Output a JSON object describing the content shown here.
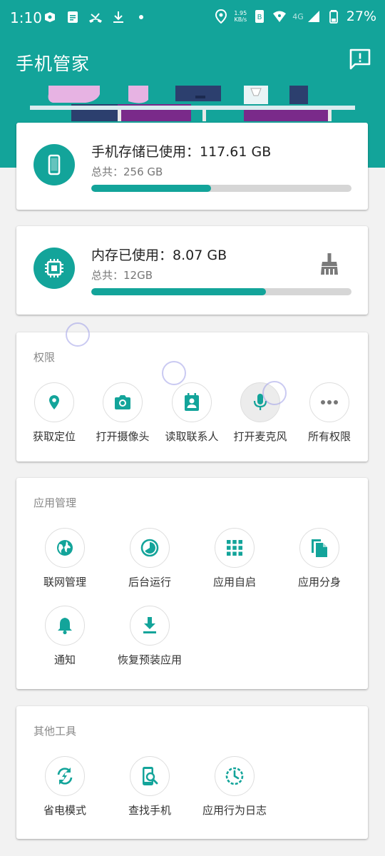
{
  "status_bar": {
    "time": "1:10",
    "net_speed_value": "1.95",
    "net_speed_unit": "KB/s",
    "network_type": "4G",
    "battery": "27%"
  },
  "app_bar": {
    "title": "手机管家"
  },
  "storage": {
    "used_label": "手机存储已使用：117.61 GB",
    "total_label": "总共：256 GB",
    "used_fraction": 0.46
  },
  "memory": {
    "used_label": "内存已使用：8.07 GB",
    "total_label": "总共：12GB",
    "used_fraction": 0.67
  },
  "permissions": {
    "title": "权限",
    "items": [
      {
        "label": "获取定位",
        "icon": "location-icon"
      },
      {
        "label": "打开摄像头",
        "icon": "camera-icon"
      },
      {
        "label": "读取联系人",
        "icon": "contacts-icon"
      },
      {
        "label": "打开麦克风",
        "icon": "microphone-icon"
      },
      {
        "label": "所有权限",
        "icon": "more-icon"
      }
    ]
  },
  "app_management": {
    "title": "应用管理",
    "items": [
      {
        "label": "联网管理",
        "icon": "globe-icon"
      },
      {
        "label": "后台运行",
        "icon": "pie-timer-icon"
      },
      {
        "label": "应用自启",
        "icon": "grid-icon"
      },
      {
        "label": "应用分身",
        "icon": "copy-icon"
      },
      {
        "label": "通知",
        "icon": "bell-icon"
      },
      {
        "label": "恢复预装应用",
        "icon": "download-icon"
      }
    ]
  },
  "other_tools": {
    "title": "其他工具",
    "items": [
      {
        "label": "省电模式",
        "icon": "battery-saver-icon"
      },
      {
        "label": "查找手机",
        "icon": "find-phone-icon"
      },
      {
        "label": "应用行为日志",
        "icon": "activity-log-icon"
      }
    ]
  },
  "colors": {
    "accent": "#13a49a",
    "bar_track": "#d6d6d6",
    "page_bg": "#f2f2f2"
  }
}
